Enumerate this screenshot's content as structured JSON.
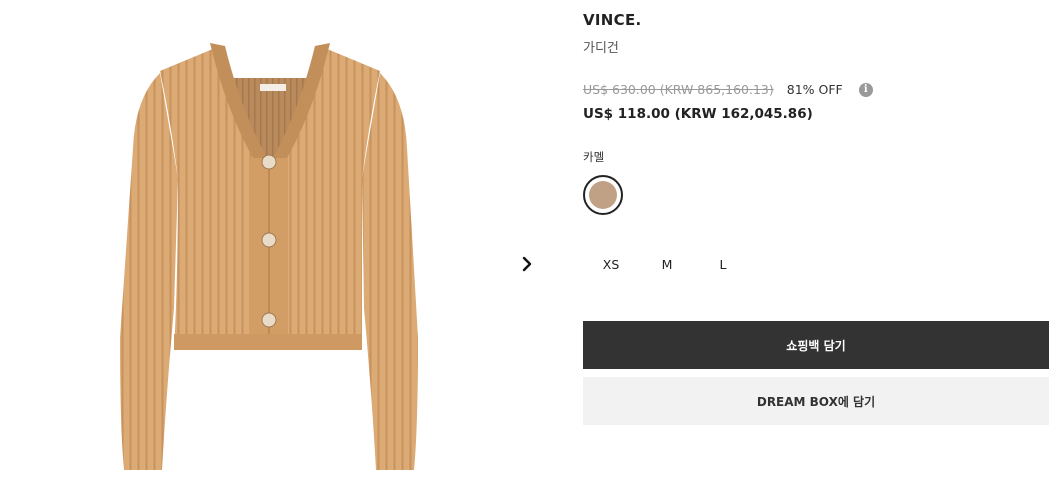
{
  "product": {
    "brand": "VINCE.",
    "category": "가디건",
    "old_price": "US$ 630.00 (KRW 865,160.13)",
    "discount": "81% OFF",
    "info_icon_glyph": "i",
    "current_price": "US$ 118.00 (KRW 162,045.86)",
    "color_label": "카멜",
    "color_swatch": "#c0a185",
    "knit_color": "#dcaa74"
  },
  "sizes": [
    "XS",
    "M",
    "L"
  ],
  "actions": {
    "add_to_bag": "쇼핑백 담기",
    "dream_box": "DREAM BOX에 담기"
  },
  "icons": {
    "next": "chevron-right-icon",
    "info": "info-icon"
  }
}
